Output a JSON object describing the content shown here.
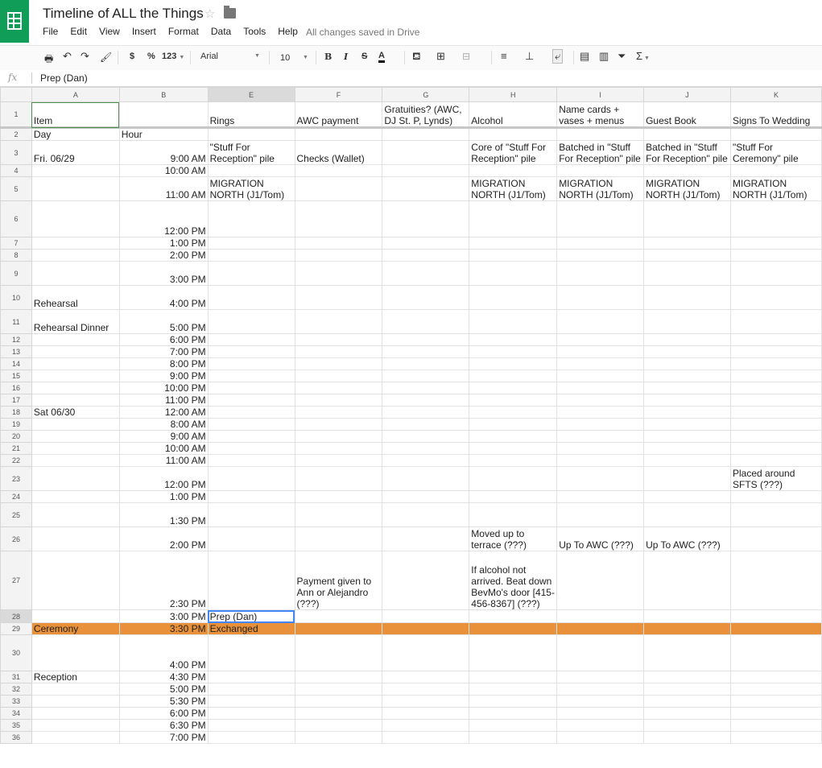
{
  "app": {
    "doc_title": "Timeline of ALL the Things",
    "save_status": "All changes saved in Drive",
    "menu": [
      "File",
      "Edit",
      "View",
      "Insert",
      "Format",
      "Data",
      "Tools",
      "Help"
    ]
  },
  "toolbar": {
    "currency": "$",
    "percent": "%",
    "number_format": "123",
    "font": "Arial",
    "font_size": "10",
    "bold": "B",
    "italic": "I",
    "strike": "S",
    "text_color": "A",
    "sum": "Σ"
  },
  "formula_bar": {
    "fx_label": "fx",
    "value": "Prep (Dan)"
  },
  "colors": {
    "brand": "#0f9d58",
    "highlight_row": "#e8913a",
    "selection": "#4285f4"
  },
  "grid": {
    "columns": [
      "A",
      "B",
      "E",
      "F",
      "G",
      "H",
      "I",
      "J",
      "K"
    ],
    "rows": [
      {
        "n": "1",
        "cells": [
          "Item",
          "",
          "Rings",
          "AWC payment",
          "Gratuities? (AWC, DJ St. P, Lynds)",
          "Alcohol",
          "Name cards + vases + menus",
          "Guest Book",
          "Signs To Wedding"
        ]
      },
      {
        "n": "2",
        "cells": [
          "Day",
          "Hour",
          "",
          "",
          "",
          "",
          "",
          "",
          ""
        ]
      },
      {
        "n": "3",
        "cells": [
          "Fri. 06/29",
          "9:00 AM",
          "\"Stuff For Reception\" pile",
          "Checks (Wallet)",
          "",
          "Core of \"Stuff For Reception\" pile",
          "Batched in \"Stuff For Reception\" pile",
          "Batched in \"Stuff For Reception\" pile",
          "\"Stuff For Ceremony\" pile"
        ]
      },
      {
        "n": "4",
        "cells": [
          "",
          "10:00 AM",
          "",
          "",
          "",
          "",
          "",
          "",
          ""
        ]
      },
      {
        "n": "5",
        "cells": [
          "",
          "11:00 AM",
          "MIGRATION NORTH (J1/Tom)",
          "",
          "",
          "MIGRATION NORTH (J1/Tom)",
          "MIGRATION NORTH (J1/Tom)",
          "MIGRATION NORTH (J1/Tom)",
          "MIGRATION NORTH (J1/Tom)"
        ]
      },
      {
        "n": "6",
        "cells": [
          "",
          "12:00 PM",
          "",
          "",
          "",
          "",
          "",
          "",
          ""
        ]
      },
      {
        "n": "7",
        "cells": [
          "",
          "1:00 PM",
          "",
          "",
          "",
          "",
          "",
          "",
          ""
        ]
      },
      {
        "n": "8",
        "cells": [
          "",
          "2:00 PM",
          "",
          "",
          "",
          "",
          "",
          "",
          ""
        ]
      },
      {
        "n": "9",
        "cells": [
          "",
          "3:00 PM",
          "",
          "",
          "",
          "",
          "",
          "",
          ""
        ]
      },
      {
        "n": "10",
        "cells": [
          "Rehearsal",
          "4:00 PM",
          "",
          "",
          "",
          "",
          "",
          "",
          ""
        ]
      },
      {
        "n": "11",
        "cells": [
          "Rehearsal Dinner",
          "5:00 PM",
          "",
          "",
          "",
          "",
          "",
          "",
          ""
        ]
      },
      {
        "n": "12",
        "cells": [
          "",
          "6:00 PM",
          "",
          "",
          "",
          "",
          "",
          "",
          ""
        ]
      },
      {
        "n": "13",
        "cells": [
          "",
          "7:00 PM",
          "",
          "",
          "",
          "",
          "",
          "",
          ""
        ]
      },
      {
        "n": "14",
        "cells": [
          "",
          "8:00 PM",
          "",
          "",
          "",
          "",
          "",
          "",
          ""
        ]
      },
      {
        "n": "15",
        "cells": [
          "",
          "9:00 PM",
          "",
          "",
          "",
          "",
          "",
          "",
          ""
        ]
      },
      {
        "n": "16",
        "cells": [
          "",
          "10:00 PM",
          "",
          "",
          "",
          "",
          "",
          "",
          ""
        ]
      },
      {
        "n": "17",
        "cells": [
          "",
          "11:00 PM",
          "",
          "",
          "",
          "",
          "",
          "",
          ""
        ]
      },
      {
        "n": "18",
        "cells": [
          "Sat 06/30",
          "12:00 AM",
          "",
          "",
          "",
          "",
          "",
          "",
          ""
        ]
      },
      {
        "n": "19",
        "cells": [
          "",
          "8:00 AM",
          "",
          "",
          "",
          "",
          "",
          "",
          ""
        ]
      },
      {
        "n": "20",
        "cells": [
          "",
          "9:00 AM",
          "",
          "",
          "",
          "",
          "",
          "",
          ""
        ]
      },
      {
        "n": "21",
        "cells": [
          "",
          "10:00 AM",
          "",
          "",
          "",
          "",
          "",
          "",
          ""
        ]
      },
      {
        "n": "22",
        "cells": [
          "",
          "11:00 AM",
          "",
          "",
          "",
          "",
          "",
          "",
          ""
        ]
      },
      {
        "n": "23",
        "cells": [
          "",
          "12:00 PM",
          "",
          "",
          "",
          "",
          "",
          "",
          "Placed around SFTS (???)"
        ]
      },
      {
        "n": "24",
        "cells": [
          "",
          "1:00 PM",
          "",
          "",
          "",
          "",
          "",
          "",
          ""
        ]
      },
      {
        "n": "25",
        "cells": [
          "",
          "1:30 PM",
          "",
          "",
          "",
          "",
          "",
          "",
          ""
        ]
      },
      {
        "n": "26",
        "cells": [
          "",
          "2:00 PM",
          "",
          "",
          "",
          "Moved up to terrace (???)",
          "Up To AWC (???)",
          "Up To AWC (???)",
          ""
        ]
      },
      {
        "n": "27",
        "cells": [
          "",
          "2:30 PM",
          "",
          "Payment given to Ann or Alejandro (???)",
          "",
          "If alcohol not arrived. Beat down BevMo's door [415-456-8367] (???)",
          "",
          "",
          ""
        ]
      },
      {
        "n": "28",
        "cells": [
          "",
          "3:00 PM",
          "Prep (Dan)",
          "",
          "",
          "",
          "",
          "",
          ""
        ]
      },
      {
        "n": "29",
        "cells": [
          "Ceremony",
          "3:30 PM",
          "Exchanged",
          "",
          "",
          "",
          "",
          "",
          ""
        ]
      },
      {
        "n": "30",
        "cells": [
          "",
          "4:00 PM",
          "",
          "",
          "",
          "",
          "",
          "",
          ""
        ]
      },
      {
        "n": "31",
        "cells": [
          "Reception",
          "4:30 PM",
          "",
          "",
          "",
          "",
          "",
          "",
          ""
        ]
      },
      {
        "n": "32",
        "cells": [
          "",
          "5:00 PM",
          "",
          "",
          "",
          "",
          "",
          "",
          ""
        ]
      },
      {
        "n": "33",
        "cells": [
          "",
          "5:30 PM",
          "",
          "",
          "",
          "",
          "",
          "",
          ""
        ]
      },
      {
        "n": "34",
        "cells": [
          "",
          "6:00 PM",
          "",
          "",
          "",
          "",
          "",
          "",
          ""
        ]
      },
      {
        "n": "35",
        "cells": [
          "",
          "6:30 PM",
          "",
          "",
          "",
          "",
          "",
          "",
          ""
        ]
      },
      {
        "n": "36",
        "cells": [
          "",
          "7:00 PM",
          "",
          "",
          "",
          "",
          "",
          "",
          ""
        ]
      }
    ]
  }
}
